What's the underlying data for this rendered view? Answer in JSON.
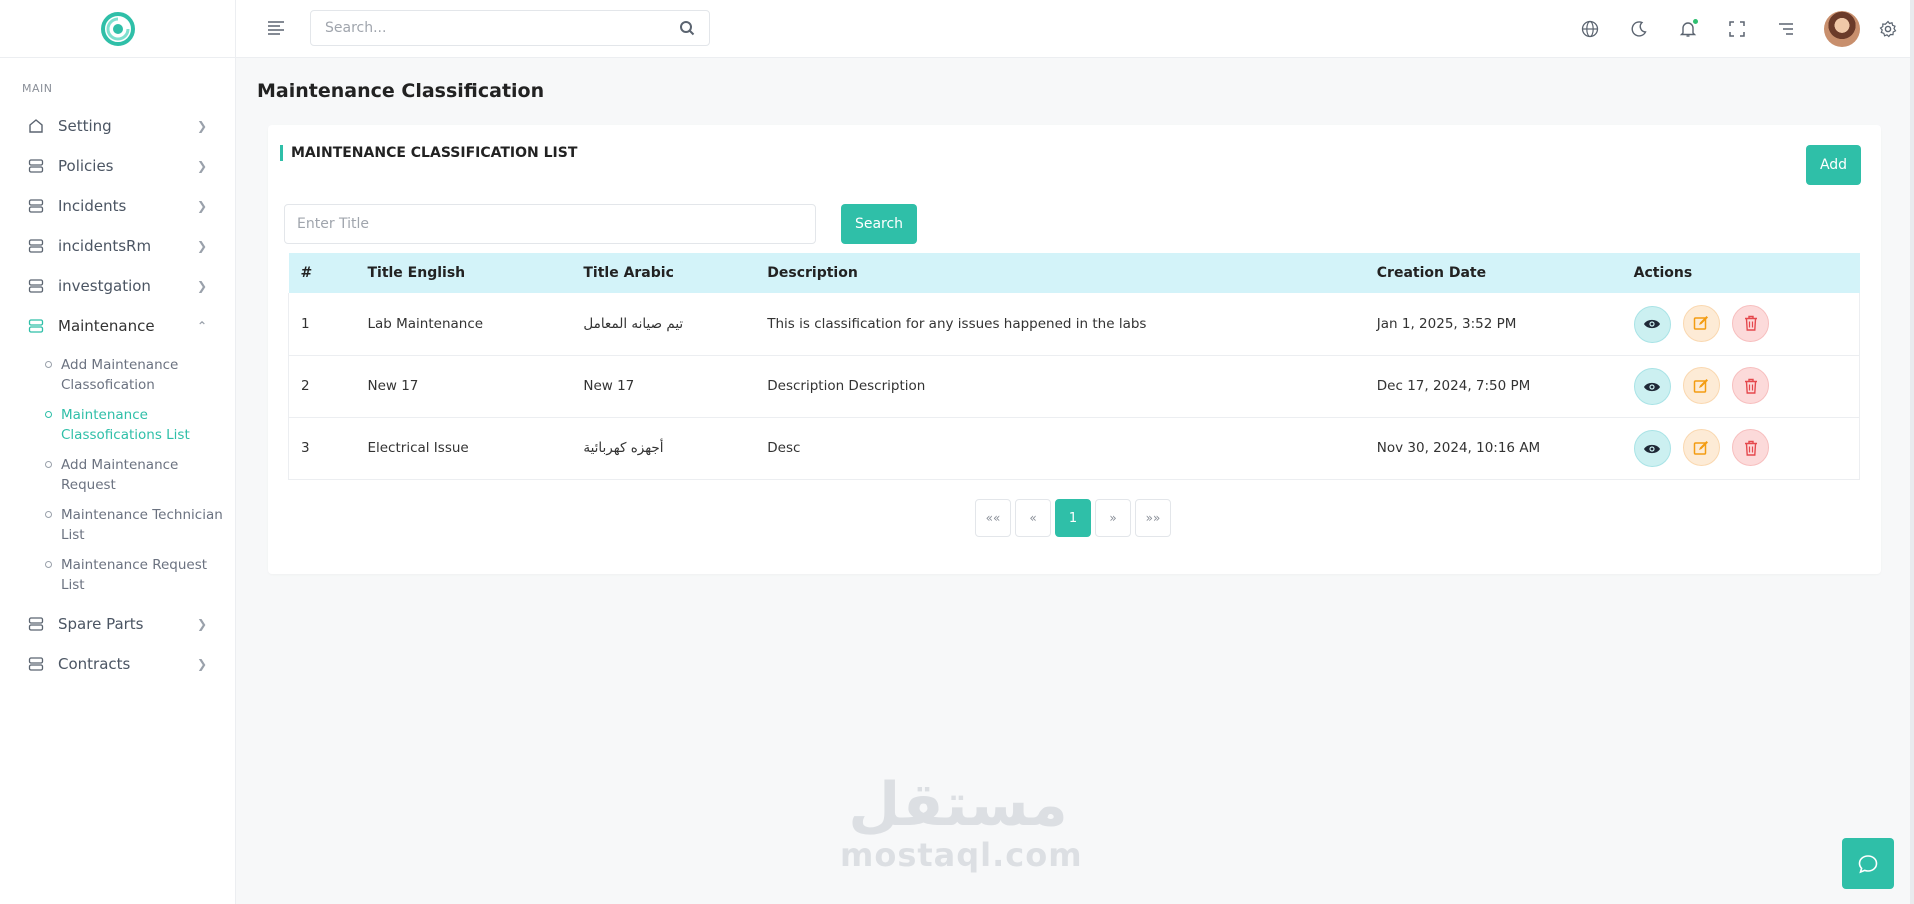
{
  "sidebar": {
    "section_label": "MAIN",
    "items": [
      {
        "label": "Setting",
        "icon": "home-icon"
      },
      {
        "label": "Policies",
        "icon": "server-icon"
      },
      {
        "label": "Incidents",
        "icon": "server-icon"
      },
      {
        "label": "incidentsRm",
        "icon": "server-icon"
      },
      {
        "label": "investgation",
        "icon": "server-icon"
      },
      {
        "label": "Maintenance",
        "icon": "server-icon"
      },
      {
        "label": "Spare Parts",
        "icon": "server-icon"
      },
      {
        "label": "Contracts",
        "icon": "server-icon"
      }
    ],
    "maintenance_sub": [
      {
        "label": "Add Maintenance Classofication"
      },
      {
        "label": "Maintenance Classofications List"
      },
      {
        "label": "Add Maintenance Request"
      },
      {
        "label": "Maintenance Technician List"
      },
      {
        "label": "Maintenance Request List"
      }
    ]
  },
  "header": {
    "search_placeholder": "Search...",
    "icons": [
      "globe-icon",
      "moon-icon",
      "bell-icon",
      "fullscreen-icon",
      "menu-lines-icon",
      "avatar",
      "gear-icon"
    ]
  },
  "page": {
    "title": "Maintenance Classification",
    "card_title": "MAINTENANCE CLASSIFICATION LIST",
    "add_label": "Add",
    "filter_placeholder": "Enter Title",
    "search_label": "Search"
  },
  "table": {
    "headers": [
      "#",
      "Title English",
      "Title Arabic",
      "Description",
      "Creation Date",
      "Actions"
    ],
    "rows": [
      {
        "num": "1",
        "title_en": "Lab Maintenance",
        "title_ar": "تيم صيانه المعامل",
        "description": "This is classification for any issues happened in the labs",
        "date": "Jan 1, 2025, 3:52 PM"
      },
      {
        "num": "2",
        "title_en": "New 17",
        "title_ar": "New 17",
        "description": "Description Description",
        "date": "Dec 17, 2024, 7:50 PM"
      },
      {
        "num": "3",
        "title_en": "Electrical Issue",
        "title_ar": "أجهزه كهربائية",
        "description": "Desc",
        "date": "Nov 30, 2024, 10:16 AM"
      }
    ]
  },
  "pagination": {
    "first": "««",
    "prev": "«",
    "current": "1",
    "next": "»",
    "last": "»»"
  },
  "watermark": {
    "arabic": "مستقل",
    "english": "mostaql.com"
  },
  "colors": {
    "accent": "#2fbfa8",
    "table_header": "#d3f3f9",
    "view": "#ccf0f1",
    "edit": "#fdebd6",
    "delete": "#fcdada"
  }
}
